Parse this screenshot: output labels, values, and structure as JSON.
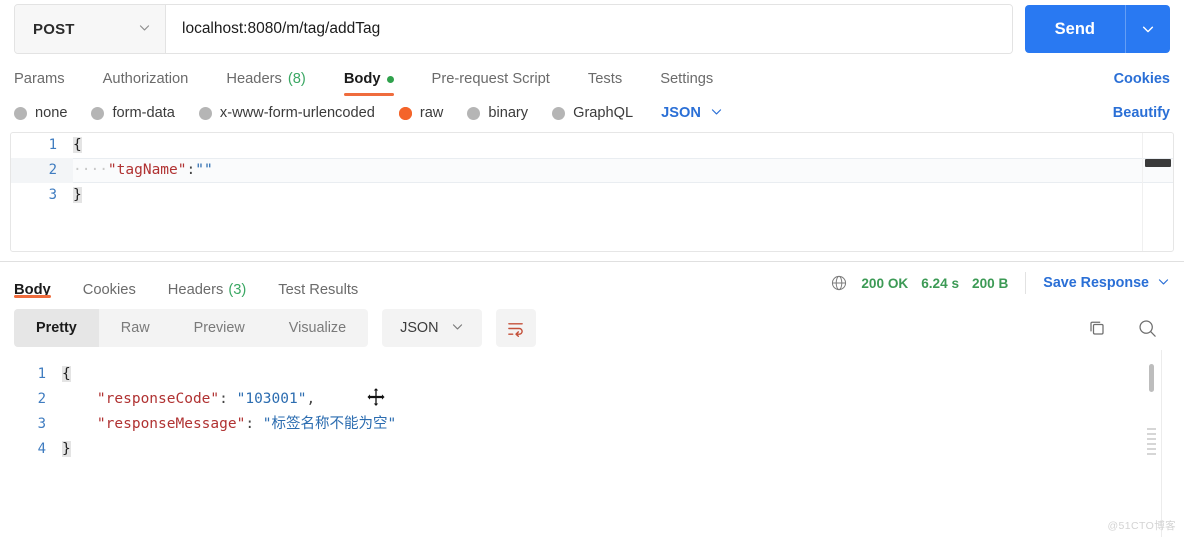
{
  "request": {
    "method": "POST",
    "url": "localhost:8080/m/tag/addTag",
    "send_label": "Send",
    "tabs": [
      {
        "label": "Params",
        "count": "",
        "active": false,
        "dot": false
      },
      {
        "label": "Authorization",
        "count": "",
        "active": false,
        "dot": false
      },
      {
        "label": "Headers",
        "count": "(8)",
        "active": false,
        "dot": false
      },
      {
        "label": "Body",
        "count": "",
        "active": true,
        "dot": true
      },
      {
        "label": "Pre-request Script",
        "count": "",
        "active": false,
        "dot": false
      },
      {
        "label": "Tests",
        "count": "",
        "active": false,
        "dot": false
      },
      {
        "label": "Settings",
        "count": "",
        "active": false,
        "dot": false
      }
    ],
    "cookies_label": "Cookies",
    "body_modes": [
      {
        "label": "none",
        "selected": false
      },
      {
        "label": "form-data",
        "selected": false
      },
      {
        "label": "x-www-form-urlencoded",
        "selected": false
      },
      {
        "label": "raw",
        "selected": true
      },
      {
        "label": "binary",
        "selected": false
      },
      {
        "label": "GraphQL",
        "selected": false
      }
    ],
    "format": "JSON",
    "beautify_label": "Beautify",
    "editor": {
      "lines": [
        {
          "num": "1",
          "segments": [
            {
              "t": "{",
              "c": "brace"
            }
          ],
          "highlight": false
        },
        {
          "num": "2",
          "segments": [
            {
              "t": "····",
              "c": "indent"
            },
            {
              "t": "\"tagName\"",
              "c": "k-key"
            },
            {
              "t": ":",
              "c": "k-punct"
            },
            {
              "t": "\"\"",
              "c": "k-str"
            }
          ],
          "highlight": true
        },
        {
          "num": "3",
          "segments": [
            {
              "t": "}",
              "c": "brace"
            }
          ],
          "highlight": false
        }
      ]
    }
  },
  "response": {
    "tabs": [
      {
        "label": "Body",
        "count": "",
        "active": true
      },
      {
        "label": "Cookies",
        "count": "",
        "active": false
      },
      {
        "label": "Headers",
        "count": "(3)",
        "active": false
      },
      {
        "label": "Test Results",
        "count": "",
        "active": false
      }
    ],
    "status": "200 OK",
    "time": "6.24 s",
    "size": "200 B",
    "save_response_label": "Save Response",
    "view_modes": [
      {
        "label": "Pretty",
        "active": true
      },
      {
        "label": "Raw",
        "active": false
      },
      {
        "label": "Preview",
        "active": false
      },
      {
        "label": "Visualize",
        "active": false
      }
    ],
    "format": "JSON",
    "body": {
      "lines": [
        {
          "num": "1",
          "segments": [
            {
              "t": "{",
              "c": "brace"
            }
          ]
        },
        {
          "num": "2",
          "segments": [
            {
              "t": "    ",
              "c": "k-punct"
            },
            {
              "t": "\"responseCode\"",
              "c": "k-key"
            },
            {
              "t": ": ",
              "c": "k-punct"
            },
            {
              "t": "\"103001\"",
              "c": "k-str"
            },
            {
              "t": ",",
              "c": "k-punct"
            }
          ]
        },
        {
          "num": "3",
          "segments": [
            {
              "t": "    ",
              "c": "k-punct"
            },
            {
              "t": "\"responseMessage\"",
              "c": "k-key"
            },
            {
              "t": ": ",
              "c": "k-punct"
            },
            {
              "t": "\"标签名称不能为空\"",
              "c": "k-str"
            }
          ]
        },
        {
          "num": "4",
          "segments": [
            {
              "t": "}",
              "c": "brace"
            }
          ]
        }
      ]
    }
  },
  "watermark": "@51CTO博客",
  "colors": {
    "accent_blue": "#2979f2",
    "link_blue": "#2a6fd6",
    "tab_underline": "#ef6c3d",
    "status_green": "#3c9a55",
    "radio_selected": "#f4642a",
    "json_key": "#b03232",
    "json_string": "#2b6cb0",
    "line_number": "#3f7cc0"
  },
  "icons": {
    "chevron_down": "chevron-down-icon",
    "globe": "globe-icon",
    "copy": "copy-icon",
    "search": "search-icon",
    "wrap": "word-wrap-icon",
    "move_cursor": "move-cursor-icon"
  }
}
